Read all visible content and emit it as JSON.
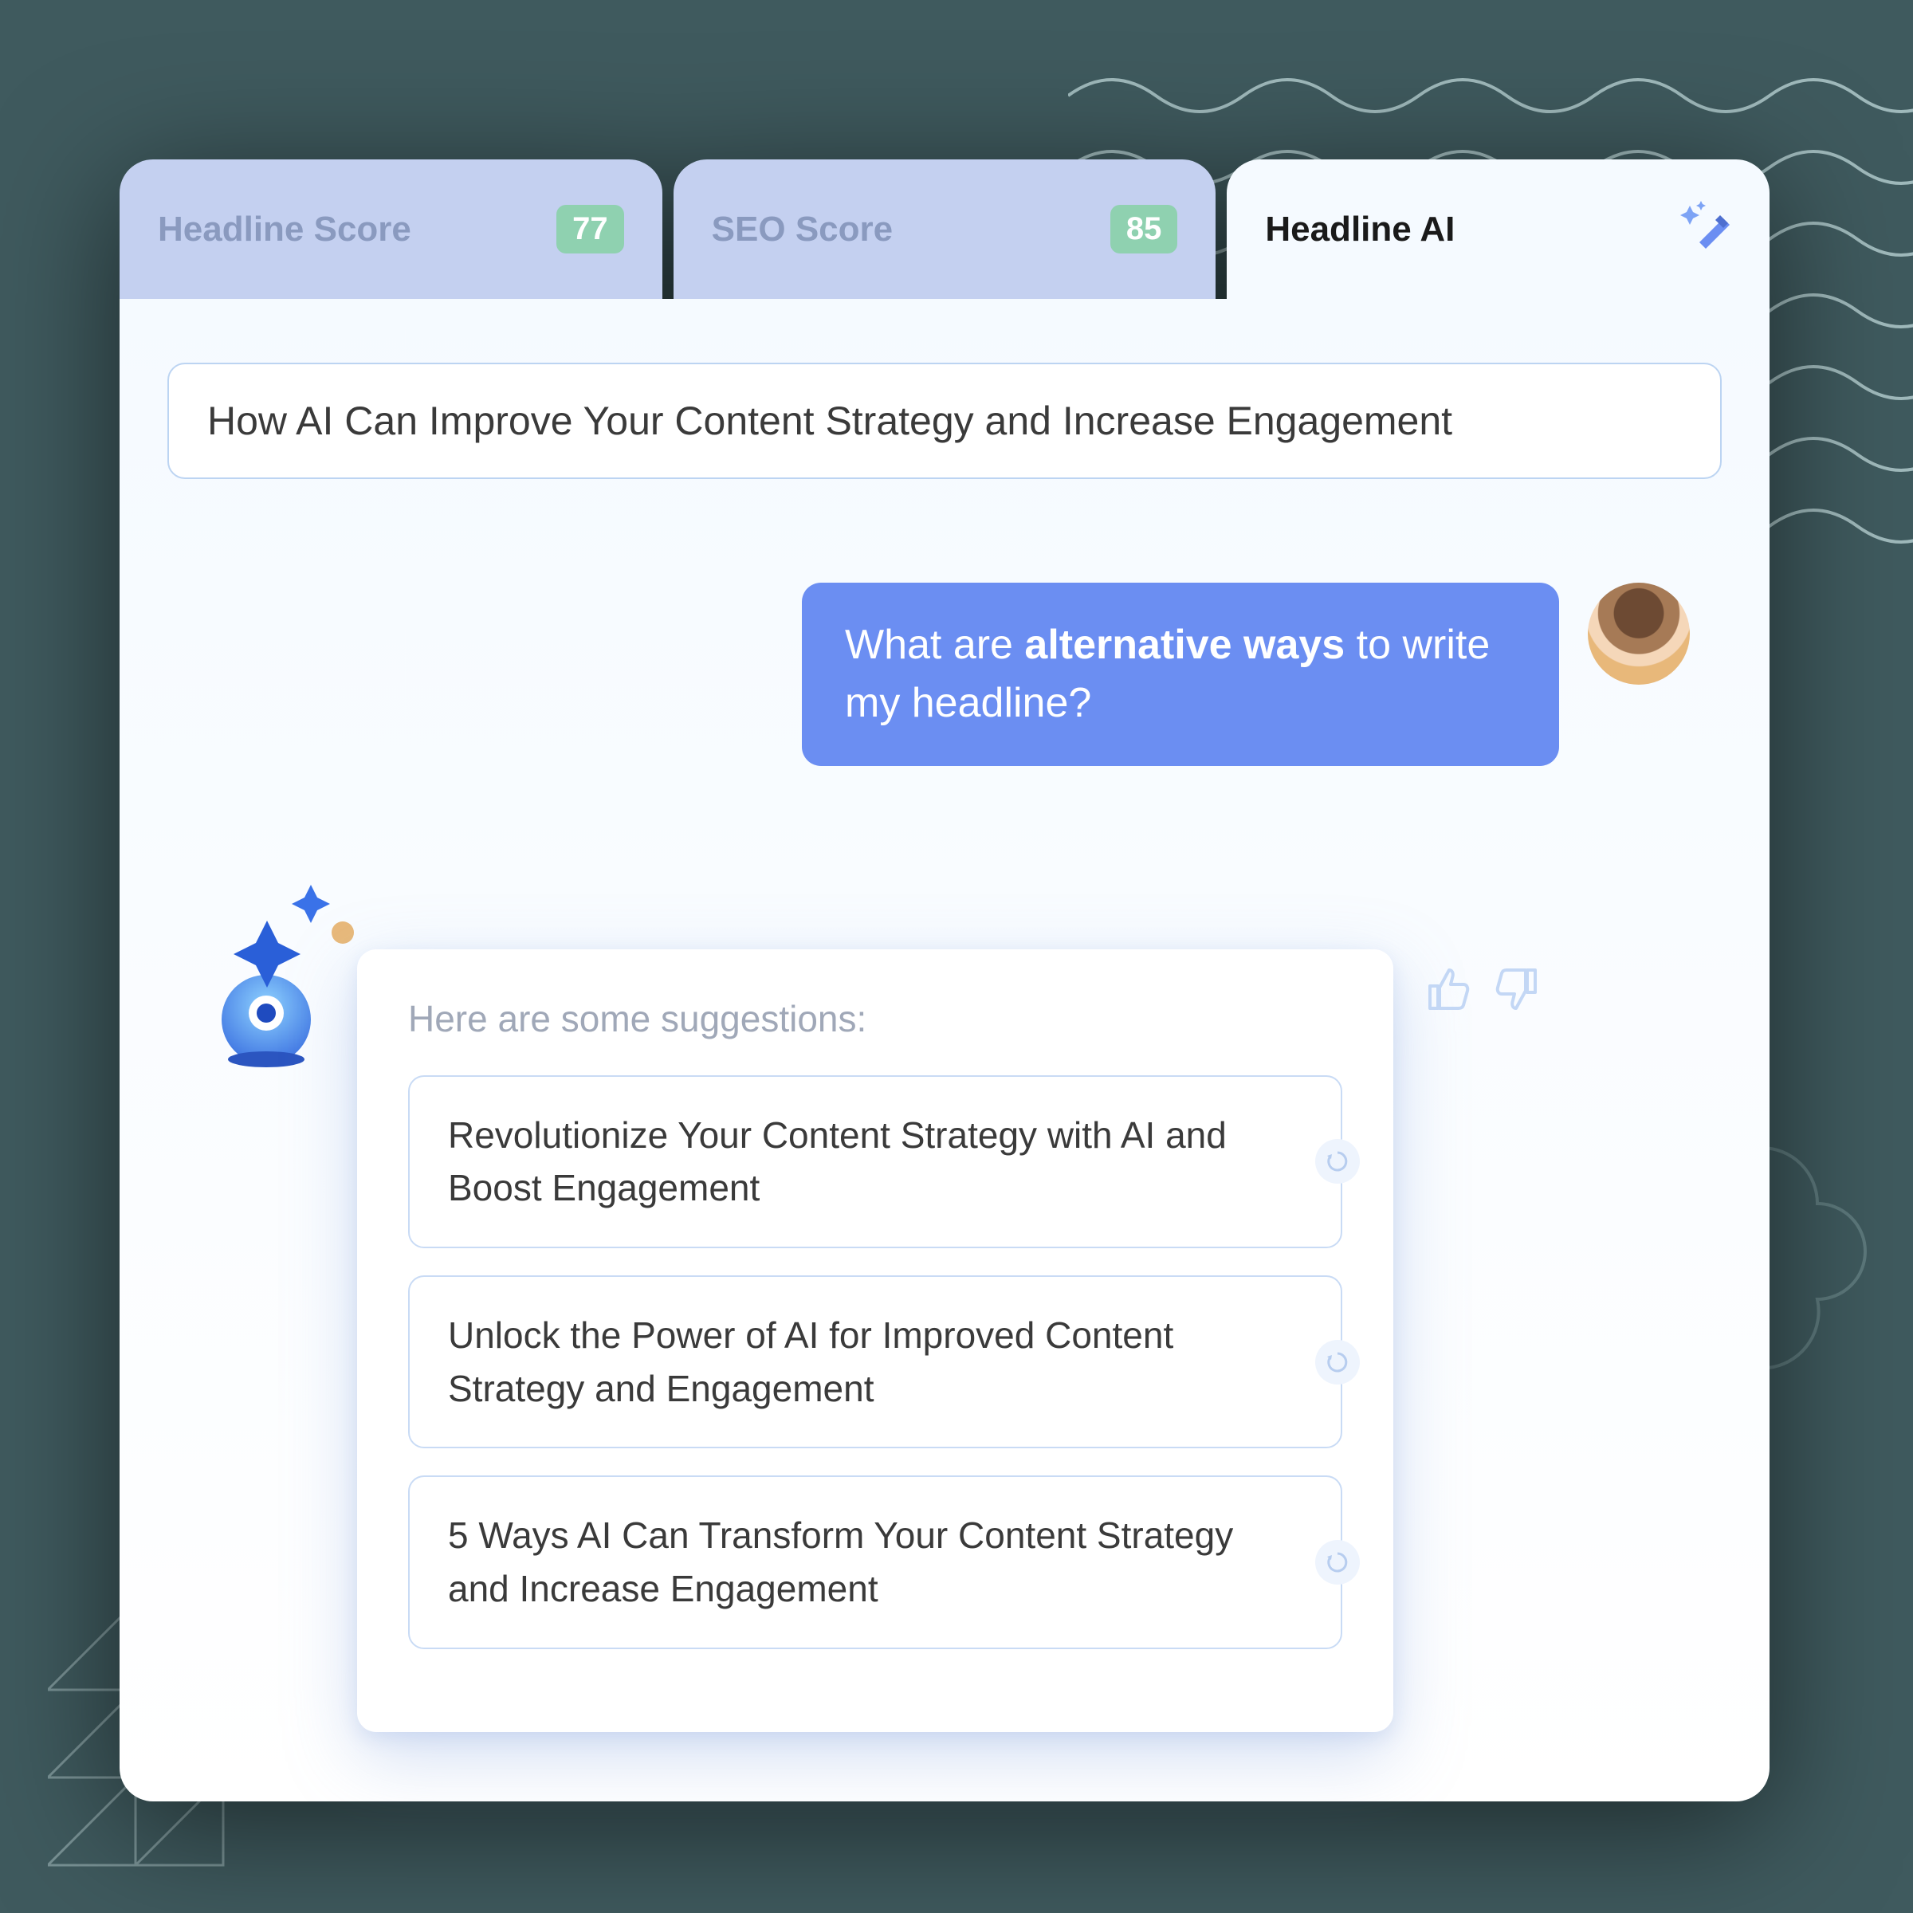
{
  "tabs": {
    "headline_score": {
      "label": "Headline Score",
      "value": "77"
    },
    "seo_score": {
      "label": "SEO Score",
      "value": "85"
    },
    "headline_ai": {
      "label": "Headline AI"
    }
  },
  "headline_input": "How AI Can Improve Your Content Strategy and Increase Engagement",
  "user_message": {
    "pre": "What are ",
    "bold": "alternative ways",
    "post": " to write my headline?"
  },
  "ai": {
    "intro": "Here are some suggestions:",
    "suggestions": [
      "Revolutionize Your Content Strategy with AI and Boost Engagement",
      "Unlock the Power of AI for Improved Content Strategy and Engagement",
      "5 Ways AI Can Transform Your Content Strategy and Increase Engagement"
    ]
  },
  "colors": {
    "accent": "#6b8ef2",
    "tab_inactive": "#c4d0f0",
    "badge": "#8fd1b0"
  }
}
